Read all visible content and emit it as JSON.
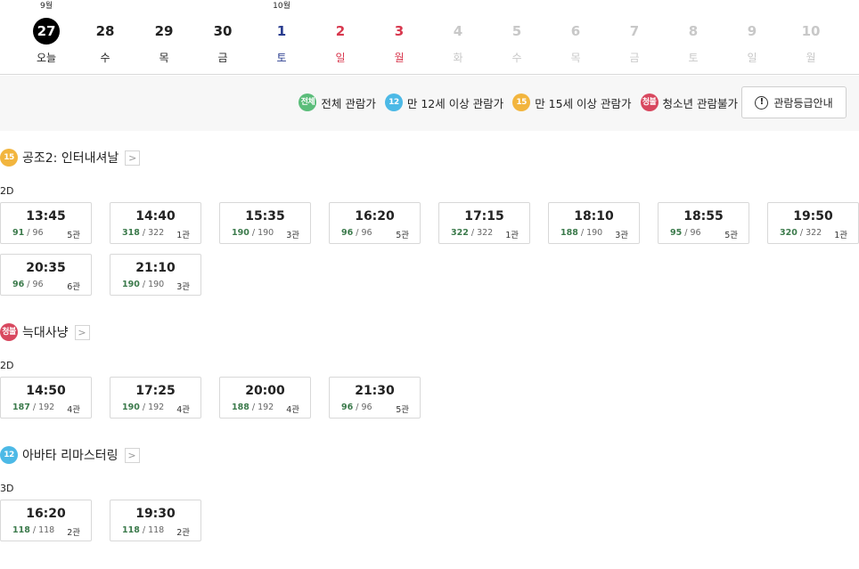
{
  "dates": [
    {
      "month": "9월",
      "day": "27",
      "weekday": "오늘",
      "state": "today"
    },
    {
      "month": "",
      "day": "28",
      "weekday": "수",
      "state": "normal"
    },
    {
      "month": "",
      "day": "29",
      "weekday": "목",
      "state": "normal"
    },
    {
      "month": "",
      "day": "30",
      "weekday": "금",
      "state": "normal"
    },
    {
      "month": "10월",
      "day": "1",
      "weekday": "토",
      "state": "sat"
    },
    {
      "month": "",
      "day": "2",
      "weekday": "일",
      "state": "sun"
    },
    {
      "month": "",
      "day": "3",
      "weekday": "월",
      "state": "sun"
    },
    {
      "month": "",
      "day": "4",
      "weekday": "화",
      "state": "disabled"
    },
    {
      "month": "",
      "day": "5",
      "weekday": "수",
      "state": "disabled"
    },
    {
      "month": "",
      "day": "6",
      "weekday": "목",
      "state": "disabled"
    },
    {
      "month": "",
      "day": "7",
      "weekday": "금",
      "state": "disabled"
    },
    {
      "month": "",
      "day": "8",
      "weekday": "토",
      "state": "disabled"
    },
    {
      "month": "",
      "day": "9",
      "weekday": "일",
      "state": "disabled"
    },
    {
      "month": "",
      "day": "10",
      "weekday": "월",
      "state": "disabled"
    }
  ],
  "legend": {
    "items": [
      {
        "badge": "전체",
        "label": "전체 관람가",
        "grade": "all"
      },
      {
        "badge": "12",
        "label": "만 12세 이상 관람가",
        "grade": "12"
      },
      {
        "badge": "15",
        "label": "만 15세 이상 관람가",
        "grade": "15"
      },
      {
        "badge": "청불",
        "label": "청소년 관람불가",
        "grade": "19"
      }
    ],
    "guide_button": "관람등급안내"
  },
  "colors": {
    "today_bg": "#000000",
    "saturday": "#2a3d8f",
    "sunday_holiday": "#d8384e",
    "disabled": "#c8c8c8",
    "remaining_seats": "#3b7a4b",
    "grade_all": "#5bbd7a",
    "grade_12": "#4cb9e6",
    "grade_15": "#f2b53e",
    "grade_19": "#d8485f"
  },
  "movies": [
    {
      "grade": "15",
      "grade_badge": "15",
      "title": "공조2: 인터내셔날",
      "format": "2D",
      "showtimes": [
        {
          "time": "13:45",
          "remaining": "91",
          "total": "96",
          "hall": "5관"
        },
        {
          "time": "14:40",
          "remaining": "318",
          "total": "322",
          "hall": "1관"
        },
        {
          "time": "15:35",
          "remaining": "190",
          "total": "190",
          "hall": "3관"
        },
        {
          "time": "16:20",
          "remaining": "96",
          "total": "96",
          "hall": "5관"
        },
        {
          "time": "17:15",
          "remaining": "322",
          "total": "322",
          "hall": "1관"
        },
        {
          "time": "18:10",
          "remaining": "188",
          "total": "190",
          "hall": "3관"
        },
        {
          "time": "18:55",
          "remaining": "95",
          "total": "96",
          "hall": "5관"
        },
        {
          "time": "19:50",
          "remaining": "320",
          "total": "322",
          "hall": "1관"
        },
        {
          "time": "20:35",
          "remaining": "96",
          "total": "96",
          "hall": "6관"
        },
        {
          "time": "21:10",
          "remaining": "190",
          "total": "190",
          "hall": "3관"
        }
      ]
    },
    {
      "grade": "19",
      "grade_badge": "청불",
      "title": "늑대사냥",
      "format": "2D",
      "showtimes": [
        {
          "time": "14:50",
          "remaining": "187",
          "total": "192",
          "hall": "4관"
        },
        {
          "time": "17:25",
          "remaining": "190",
          "total": "192",
          "hall": "4관"
        },
        {
          "time": "20:00",
          "remaining": "188",
          "total": "192",
          "hall": "4관"
        },
        {
          "time": "21:30",
          "remaining": "96",
          "total": "96",
          "hall": "5관"
        }
      ]
    },
    {
      "grade": "12",
      "grade_badge": "12",
      "title": "아바타 리마스터링",
      "format": "3D",
      "showtimes": [
        {
          "time": "16:20",
          "remaining": "118",
          "total": "118",
          "hall": "2관"
        },
        {
          "time": "19:30",
          "remaining": "118",
          "total": "118",
          "hall": "2관"
        }
      ]
    }
  ]
}
